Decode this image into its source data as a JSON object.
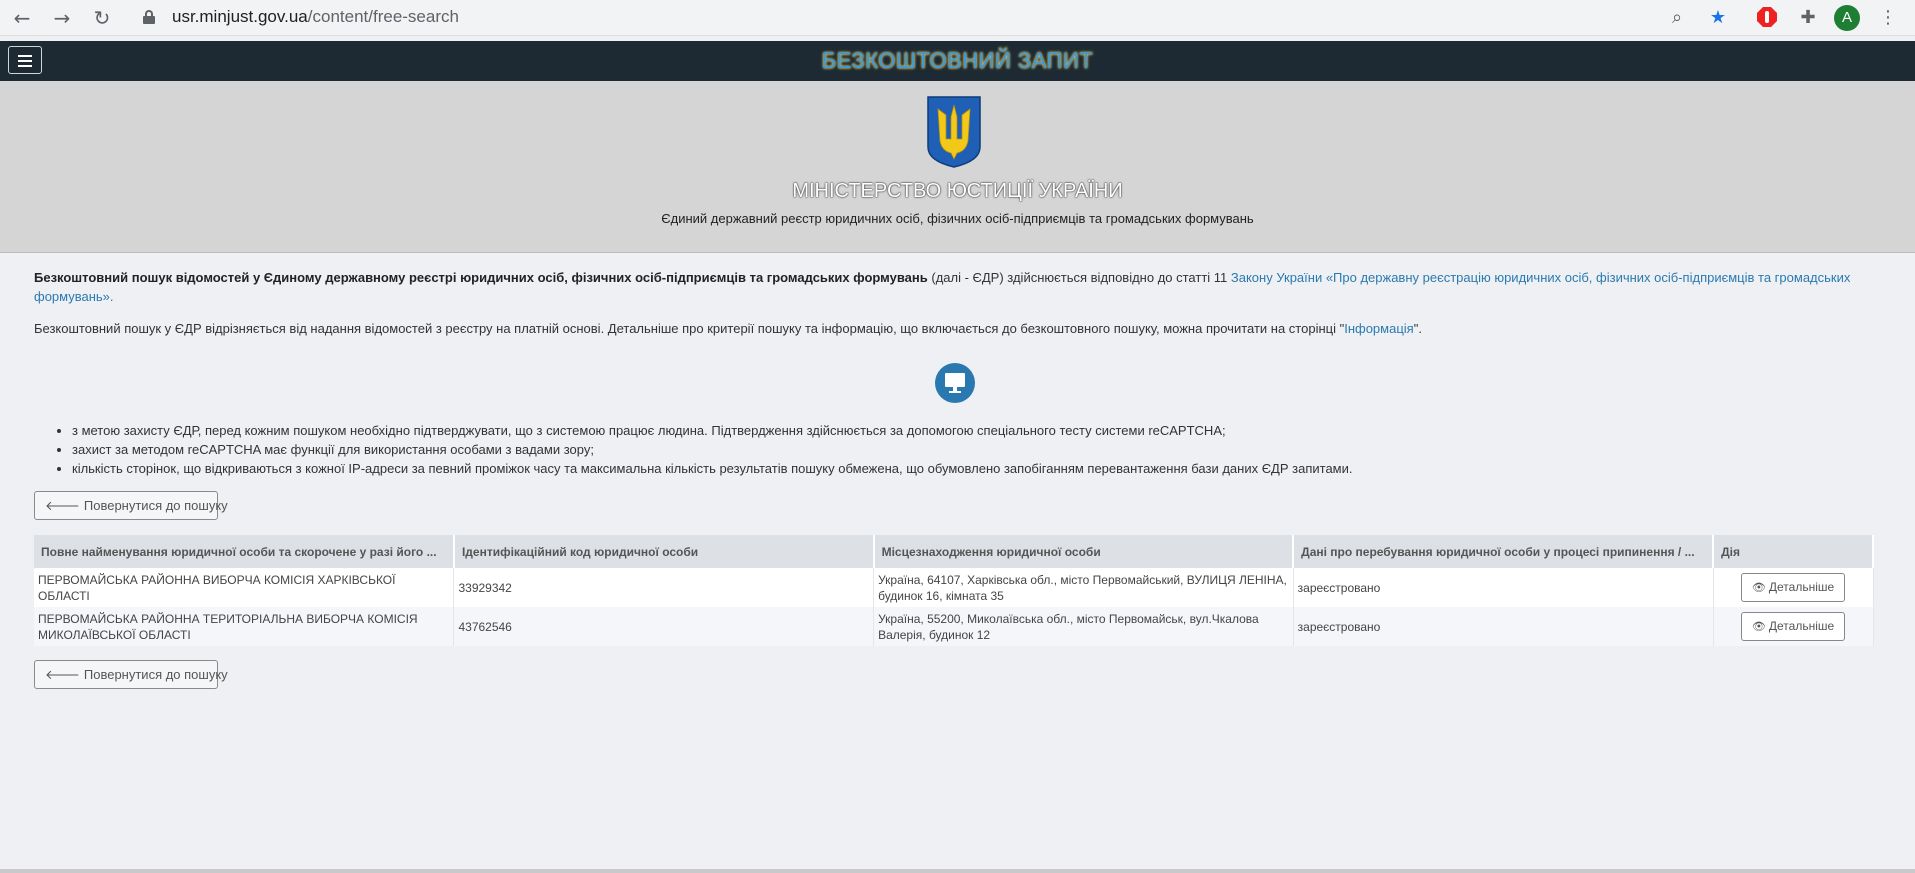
{
  "browser": {
    "url_host": "usr.minjust.gov.ua",
    "url_path": "/content/free-search",
    "avatar_letter": "A",
    "icons": [
      "back-icon",
      "forward-icon",
      "reload-icon",
      "lock-icon",
      "zoom-icon",
      "bookmark-star-icon",
      "adblock-icon",
      "extensions-icon",
      "profile-avatar",
      "more-menu-icon"
    ]
  },
  "header": {
    "title": "БЕЗКОШТОВНИЙ ЗАПИТ"
  },
  "banner": {
    "ministry": "МІНІСТЕРСТВО ЮСТИЦІЇ УКРАЇНИ",
    "registry": "Єдиний державний реєстр юридичних осіб, фізичних осіб-підприємців та громадських формувань"
  },
  "intro": {
    "bold": "Безкоштовний пошук відомостей у Єдиному державному реєстрі юридичних осіб, фізичних осіб-підприємців та громадських формувань",
    "middle": " (далі - ЄДР) здійснюється відповідно до статті 11 ",
    "law_link": "Закону України «Про державну реєстрацію юридичних осіб, фізичних осіб-підприємців та громадських формувань».",
    "p2_text": "Безкоштовний пошук у ЄДР відрізняється від надання відомостей з реєстру на платній основі. Детальніше про критерії пошуку та інформацію, що включається до безкоштовного пошуку, можна прочитати на сторінці \"",
    "p2_link": "Інформація",
    "p2_end": "\"."
  },
  "notes": [
    "з метою захисту ЄДР, перед кожним пошуком необхідно підтверджувати, що з системою працює людина. Підтвердження здійснюється за допомогою спеціального тесту системи reCAPTCHA;",
    "захист за методом reCAPTCHA має функції для використання особами з вадами зору;",
    "кількість сторінок, що відкриваються з кожної IP-адреси за певний проміжок часу та максимальна кількість результатів пошуку обмежена, що обумовлено запобіганням перевантаження бази даних ЄДР запитами."
  ],
  "back_label": "Повернутися до пошуку",
  "table": {
    "headers": [
      "Повне найменування юридичної особи та скорочене у разі його ...",
      "Ідентифікаційний код юридичної особи",
      "Місцезнаходження юридичної особи",
      "Дані про перебування юридичної особи у процесі припинення / ...",
      "Дія"
    ],
    "rows": [
      {
        "name": "ПЕРВОМАЙСЬКА РАЙОННА ВИБОРЧА КОМІСІЯ ХАРКІВСЬКОЇ ОБЛАСТІ",
        "code": "33929342",
        "address": "Україна, 64107, Харківська обл., місто Первомайський, ВУЛИЦЯ ЛЕНІНА, будинок 16, кімната 35",
        "status": "зареєстровано",
        "action": "Детальніше"
      },
      {
        "name": "ПЕРВОМАЙСЬКА РАЙОННА ТЕРИТОРІАЛЬНА ВИБОРЧА КОМІСІЯ МИКОЛАЇВСЬКОЇ ОБЛАСТІ",
        "code": "43762546",
        "address": "Україна, 55200, Миколаївська обл., місто Первомайськ, вул.Чкалова Валерія, будинок 12",
        "status": "зареєстровано",
        "action": "Детальніше"
      }
    ]
  }
}
